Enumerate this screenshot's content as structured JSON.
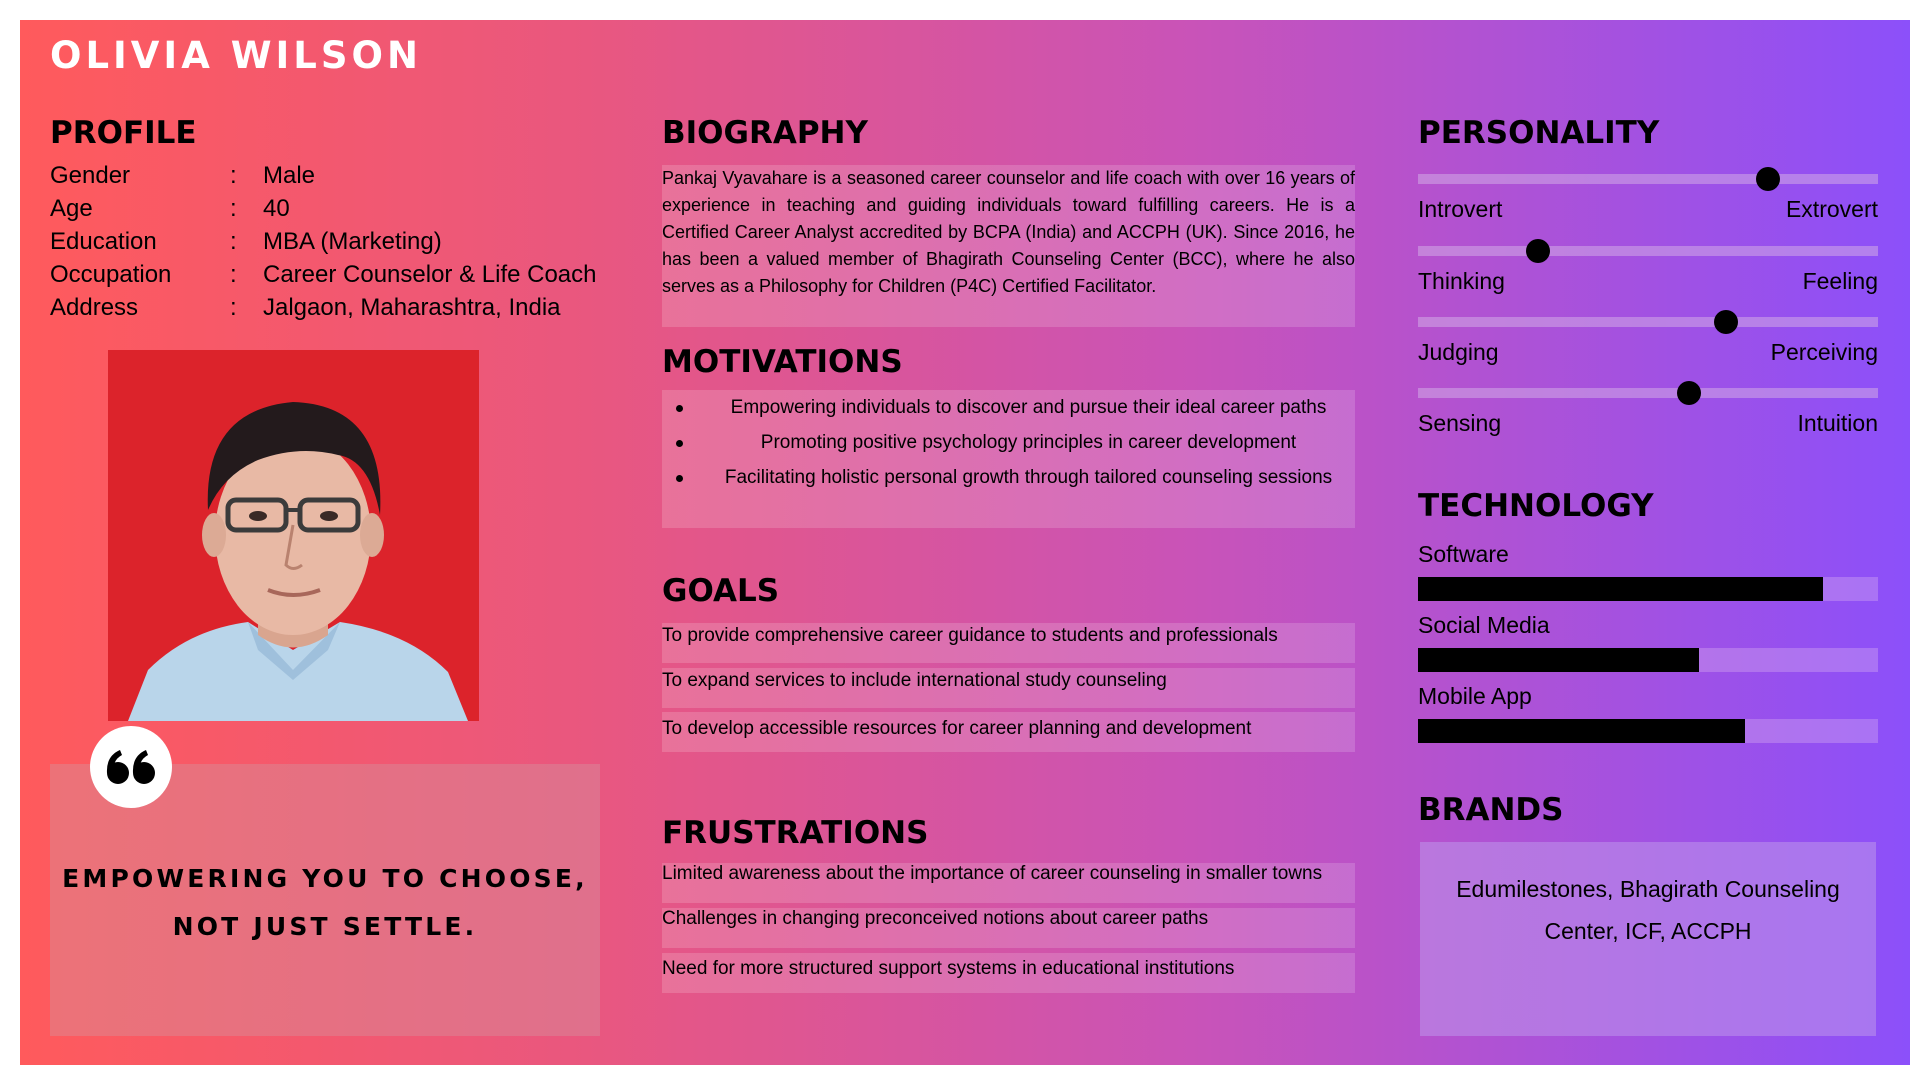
{
  "persona_name": "OLIVIA WILSON",
  "profile": {
    "heading": "PROFILE",
    "separator": ":",
    "rows": [
      {
        "label": "Gender",
        "value": "Male"
      },
      {
        "label": "Age",
        "value": "40"
      },
      {
        "label": "Education",
        "value": "MBA  (Marketing)"
      },
      {
        "label": "Occupation",
        "value": "Career Counselor & Life Coach"
      },
      {
        "label": "Address",
        "value": " Jalgaon, Maharashtra, India"
      }
    ]
  },
  "quote": {
    "icon": "quote-icon",
    "text": "EMPOWERING YOU TO CHOOSE, NOT JUST SETTLE."
  },
  "biography": {
    "heading": "BIOGRAPHY",
    "text": "Pankaj Vyavahare is a seasoned career counselor and life coach with over 16 years of experience in teaching and guiding individuals toward fulfilling careers. He is a Certified Career Analyst accredited by BCPA (India) and ACCPH (UK). Since 2016, he has been a valued member of Bhagirath Counseling Center (BCC), where he also serves as a Philosophy for Children (P4C) Certified Facilitator."
  },
  "motivations": {
    "heading": "MOTIVATIONS",
    "items": [
      "Empowering individuals to discover and pursue their ideal career paths",
      "Promoting positive psychology principles in career development",
      "Facilitating holistic personal growth through tailored counseling sessions"
    ]
  },
  "goals": {
    "heading": "GOALS",
    "items": [
      "To provide comprehensive career guidance to students and professionals",
      "To expand services to include international study counseling",
      "To develop accessible resources for career planning and development"
    ]
  },
  "frustrations": {
    "heading": "FRUSTRATIONS",
    "items": [
      "Limited awareness about the importance of career counseling in smaller towns",
      "Challenges in changing preconceived notions about career paths",
      "Need for more structured support systems in educational institutions"
    ]
  },
  "personality": {
    "heading": "PERSONALITY",
    "traits": [
      {
        "left": "Introvert",
        "right": "Extrovert",
        "position": 0.76
      },
      {
        "left": "Thinking",
        "right": "Feeling",
        "position": 0.26
      },
      {
        "left": "Judging",
        "right": "Perceiving",
        "position": 0.67
      },
      {
        "left": "Sensing",
        "right": "Intuition",
        "position": 0.59
      }
    ]
  },
  "technology": {
    "heading": "TECHNOLOGY",
    "items": [
      {
        "label": "Software",
        "level": 0.88
      },
      {
        "label": "Social Media",
        "level": 0.61
      },
      {
        "label": "Mobile App",
        "level": 0.71
      }
    ]
  },
  "brands": {
    "heading": "BRANDS",
    "text": "Edumilestones, Bhagirath Counseling Center, ICF, ACCPH"
  },
  "colors": {
    "gradient_start": "#ff5a5c",
    "gradient_end": "#8c50fa",
    "text": "#000000",
    "title": "#ffffff"
  }
}
